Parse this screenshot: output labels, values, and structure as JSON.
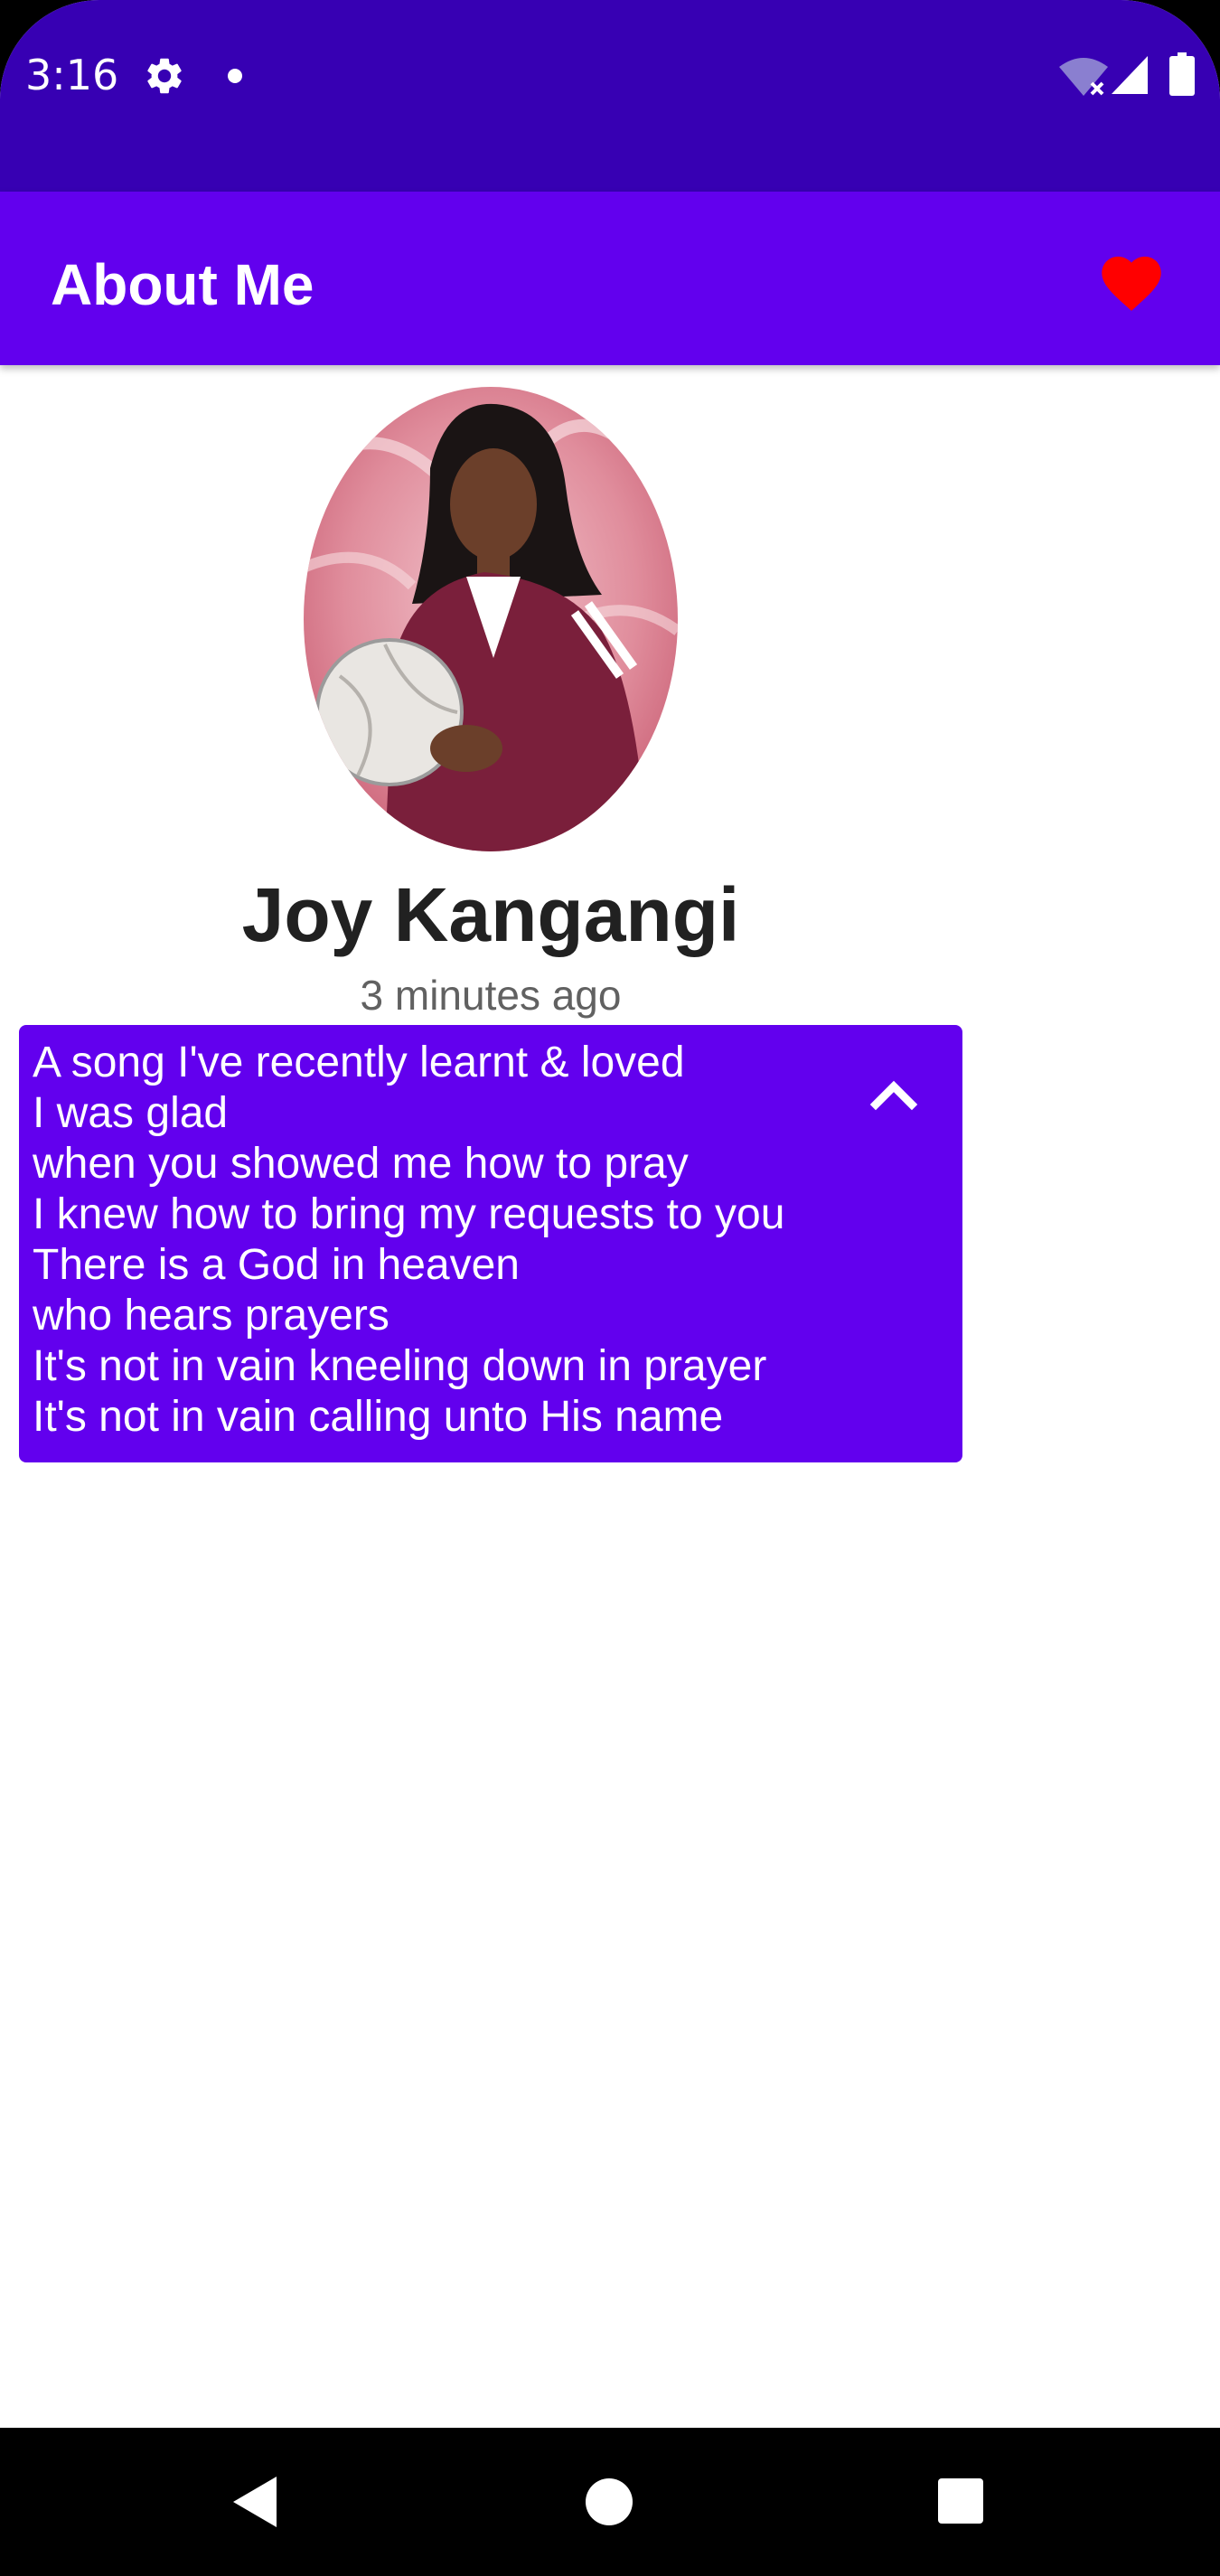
{
  "status_bar": {
    "time": "3:16",
    "icons": [
      "gear-icon",
      "notification-dot-icon",
      "wifi-off-icon",
      "signal-icon",
      "battery-icon"
    ]
  },
  "app_bar": {
    "title": "About Me",
    "action_icon": "heart-icon"
  },
  "profile": {
    "name": "Joy Kangangi",
    "timestamp": "3 minutes ago",
    "avatar_icon": "profile-photo"
  },
  "lyrics": {
    "lines": [
      "A song I've recently learnt & loved",
      "I was glad",
      "when you showed me how to pray",
      "I knew how to bring my requests to you",
      "There is a God in heaven",
      "who hears prayers",
      "It's not in vain kneeling down in prayer",
      "It's not in vain calling unto His name"
    ],
    "toggle_icon": "chevron-up-icon"
  },
  "nav_bar": {
    "icons": [
      "back-icon",
      "home-icon",
      "recents-icon"
    ]
  },
  "colors": {
    "status_bar": "#3700B3",
    "primary": "#6200EE",
    "heart": "#FF0000",
    "name_text": "#212121",
    "timestamp_text": "#616161"
  }
}
